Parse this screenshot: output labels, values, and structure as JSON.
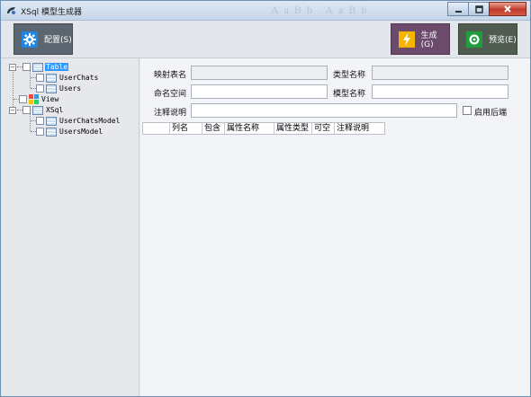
{
  "window": {
    "title": "XSql 模型生成器",
    "title_decor": "AaBb AaBb",
    "buttons": {
      "minimize": "minimize-icon",
      "maximize": "maximize-icon",
      "close": "close-icon"
    }
  },
  "toolbar": {
    "config_label": "配置(S)",
    "generate_label": "生成(G)",
    "preview_label": "预览(E)",
    "icons": {
      "config": "gear-icon",
      "generate": "lightning-icon",
      "preview": "preview-icon"
    },
    "colors": {
      "config": "#5b6670",
      "generate": "#6b4a6b",
      "preview": "#4f5c4f"
    }
  },
  "tree": {
    "table": {
      "label": "Table",
      "children": [
        "UserChats",
        "Users"
      ]
    },
    "view": {
      "label": "View"
    },
    "xsql": {
      "label": "XSql",
      "children": [
        "UserChatsModel",
        "UsersModel"
      ]
    }
  },
  "form": {
    "mapping_table_label": "映射表名",
    "mapping_table_value": "",
    "type_name_label": "类型名称",
    "type_name_value": "",
    "namespace_label": "命名空间",
    "namespace_value": "",
    "model_name_label": "模型名称",
    "model_name_value": "",
    "comment_label": "注释说明",
    "comment_value": "",
    "enable_backend_label": "启用后端"
  },
  "grid": {
    "columns": [
      "",
      "列名",
      "包含",
      "属性名称",
      "属性类型",
      "可空",
      "注释说明"
    ]
  }
}
